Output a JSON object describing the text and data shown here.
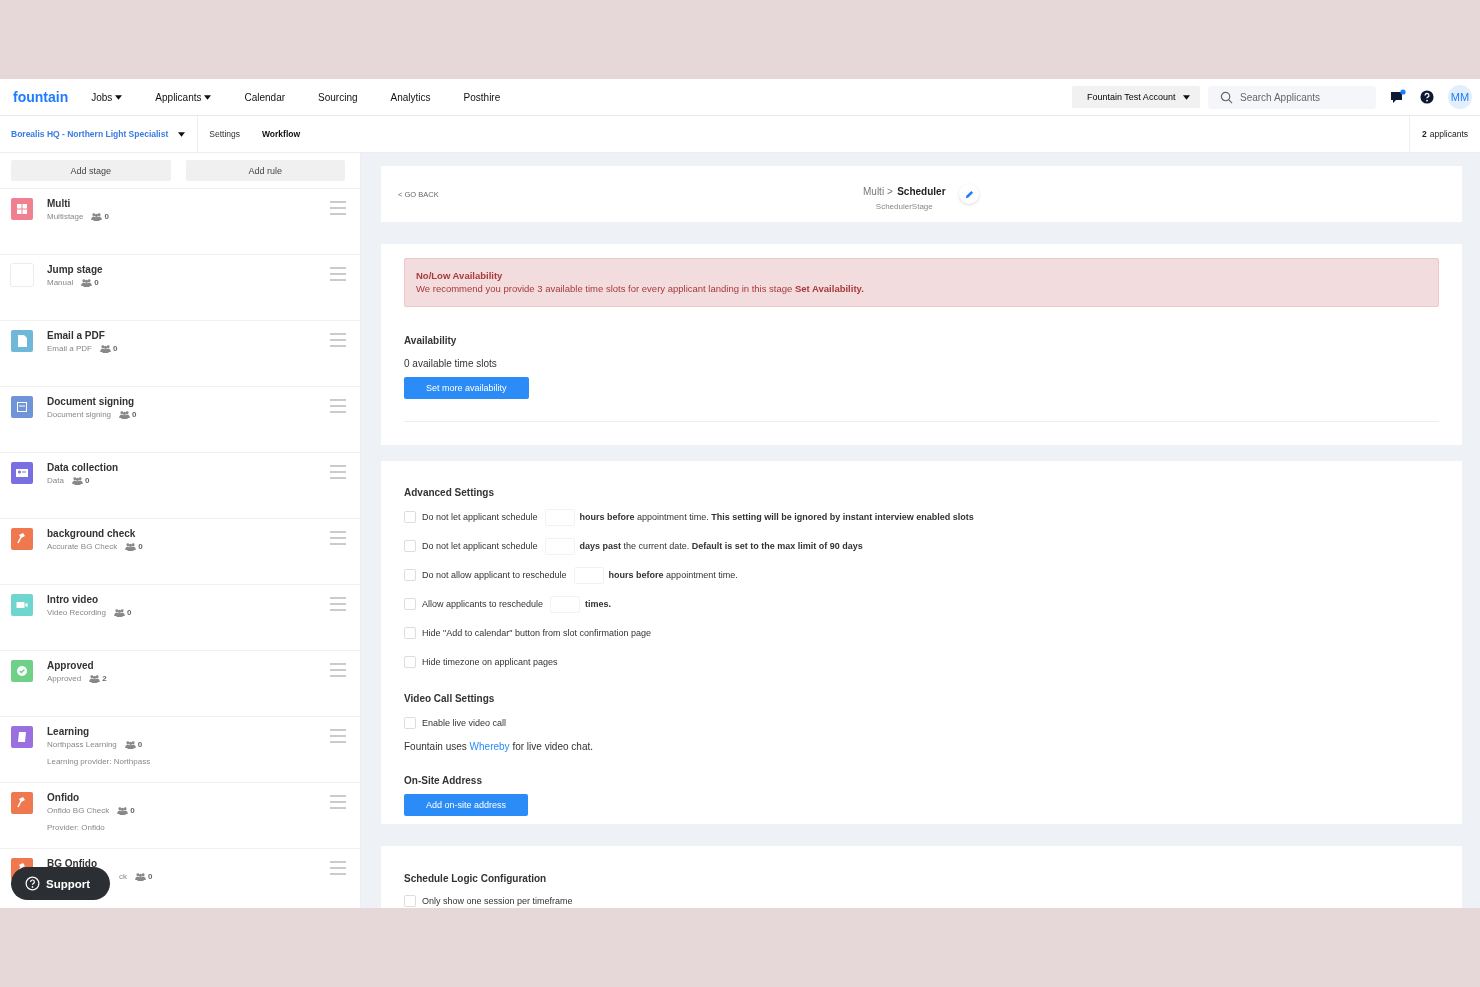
{
  "nav": {
    "logo": "fountain",
    "items": [
      {
        "label": "Jobs",
        "dropdown": true
      },
      {
        "label": "Applicants",
        "dropdown": true
      },
      {
        "label": "Calendar",
        "dropdown": false
      },
      {
        "label": "Sourcing",
        "dropdown": false
      },
      {
        "label": "Analytics",
        "dropdown": false
      },
      {
        "label": "Posthire",
        "dropdown": false
      }
    ],
    "account": "Fountain Test Account",
    "search": {
      "placeholder": "Search Applicants"
    },
    "messages_unread": true,
    "avatar": "MM"
  },
  "subbar": {
    "job": "Borealis HQ - Northern Light Specialist",
    "tabs": [
      {
        "label": "Settings",
        "selected": false
      },
      {
        "label": "Workflow",
        "selected": true
      }
    ],
    "applicants": "**2** applicants"
  },
  "sidebar": {
    "buttons": [
      "Add stage",
      "Add rule"
    ],
    "stages": [
      {
        "title": "Multi",
        "subtitle": "Multistage",
        "count": "0",
        "kind": "multistage",
        "color": "#f07f8f"
      },
      {
        "title": "Jump stage",
        "subtitle": "Manual",
        "count": "0",
        "kind": "manual",
        "color": "#ffffff"
      },
      {
        "title": "Email a PDF",
        "subtitle": "Email a PDF",
        "count": "0",
        "kind": "pdf",
        "color": "#6fb8d8"
      },
      {
        "title": "Document signing",
        "subtitle": "Document signing",
        "count": "0",
        "kind": "signing",
        "color": "#6f94d8"
      },
      {
        "title": "Data collection",
        "subtitle": "Data",
        "count": "0",
        "kind": "data",
        "color": "#7a6fe0"
      },
      {
        "title": "background check",
        "subtitle": "Accurate BG Check",
        "count": "0",
        "kind": "bgcheck",
        "color": "#f0784f"
      },
      {
        "title": "Intro video",
        "subtitle": "Video Recording",
        "count": "0",
        "kind": "video",
        "color": "#6fd6cf"
      },
      {
        "title": "Approved",
        "subtitle": "Approved",
        "count": "2",
        "kind": "approved",
        "color": "#6fd087"
      },
      {
        "title": "Learning",
        "subtitle": "Northpass Learning",
        "count": "0",
        "kind": "learning",
        "color": "#9a6fe0",
        "note": "Learning provider: Northpass"
      },
      {
        "title": "Onfido",
        "subtitle": "Onfido BG Check",
        "count": "0",
        "kind": "bgcheck",
        "color": "#f0784f",
        "note": "Provider: Onfido"
      },
      {
        "title": "BG Onfido",
        "subtitle": "ck",
        "count": "0",
        "kind": "bgcheck",
        "color": "#f0784f",
        "partial": true
      }
    ],
    "support": "Support"
  },
  "header": {
    "back": "< GO BACK",
    "parent": "Multi >",
    "title": "Scheduler",
    "subtitle": "SchedulerStage"
  },
  "alert": {
    "title": "No/Low Availability",
    "text": "We recommend you provide 3 available time slots for every applicant landing in this stage **Set Availability.**"
  },
  "availability": {
    "heading": "Availability",
    "slots": "0 available time slots",
    "button": "Set more availability"
  },
  "advanced": {
    "heading": "Advanced Settings",
    "rows": [
      {
        "kind": "field",
        "checked": false,
        "before": "Do not let applicant schedule",
        "after": "**hours before** appointment time. **This setting will be ignored by instant interview enabled slots**"
      },
      {
        "kind": "field",
        "checked": false,
        "before": "Do not let applicant schedule",
        "after": "**days past** the current date. **Default is set to the max limit of 90 days**"
      },
      {
        "kind": "field",
        "checked": false,
        "before": "Do not allow applicant to reschedule",
        "after": "**hours before** appointment time."
      },
      {
        "kind": "field",
        "checked": false,
        "before": "Allow applicants to reschedule",
        "after": "**times.**"
      },
      {
        "kind": "plain",
        "checked": false,
        "before": "Hide \"Add to calendar\" button from slot confirmation page"
      },
      {
        "kind": "plain",
        "checked": false,
        "before": "Hide timezone on applicant pages"
      }
    ]
  },
  "video": {
    "heading": "Video Call Settings",
    "rows": [
      {
        "checked": false,
        "before": "Enable live video call"
      }
    ],
    "note_before": "Fountain uses",
    "link": "Whereby",
    "note_after": "for live video chat."
  },
  "onsite": {
    "heading": "On-Site Address",
    "button": "Add on-site address"
  },
  "logic": {
    "heading": "Schedule Logic Configuration",
    "rows": [
      {
        "checked": false,
        "before": "Only show one session per timeframe"
      }
    ]
  }
}
